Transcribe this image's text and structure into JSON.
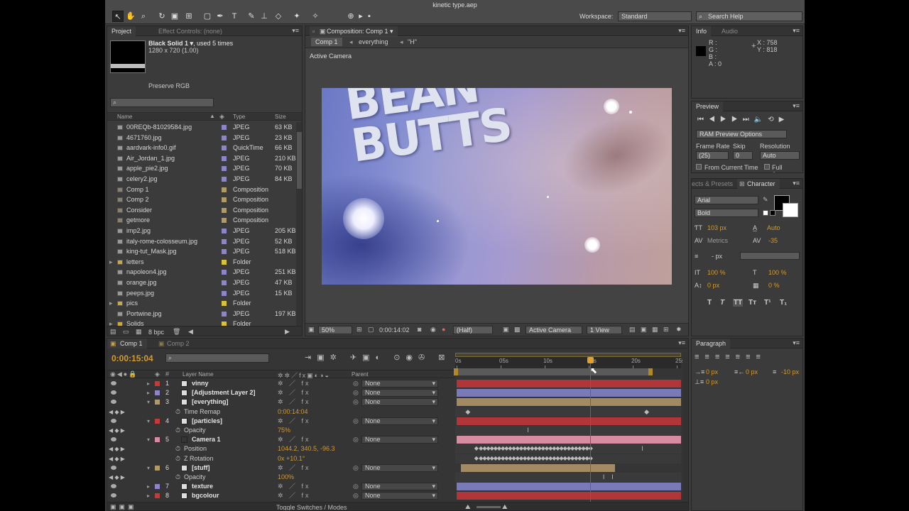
{
  "window": {
    "title": "kinetic type.aep"
  },
  "toolbar": {
    "workspace_label": "Workspace:",
    "workspace_value": "Standard",
    "search_placeholder": "Search Help"
  },
  "project": {
    "tabs": [
      "Project",
      "Effect Controls: (none)"
    ],
    "selected_name": "Black Solid 1 ▾",
    "selected_used": ", used 5 times",
    "selected_dims": "1280 x 720 (1.00)",
    "preserve": "Preserve RGB",
    "columns": {
      "name": "Name",
      "type": "Type",
      "size": "Size"
    },
    "items": [
      {
        "name": "00REQb-81029584.jpg",
        "type": "JPEG",
        "size": "63 KB",
        "color": "#8c86c9"
      },
      {
        "name": "4671760.jpg",
        "type": "JPEG",
        "size": "23 KB",
        "color": "#8c86c9"
      },
      {
        "name": "aardvark-info0.gif",
        "type": "QuickTime",
        "size": "66 KB",
        "color": "#8c86c9"
      },
      {
        "name": "Air_Jordan_1.jpg",
        "type": "JPEG",
        "size": "210 KB",
        "color": "#8c86c9"
      },
      {
        "name": "apple_pie2.jpg",
        "type": "JPEG",
        "size": "70 KB",
        "color": "#8c86c9"
      },
      {
        "name": "celery2.jpg",
        "type": "JPEG",
        "size": "84 KB",
        "color": "#8c86c9"
      },
      {
        "name": "Comp 1",
        "type": "Composition",
        "size": "",
        "color": "#b09a6a"
      },
      {
        "name": "Comp 2",
        "type": "Composition",
        "size": "",
        "color": "#b09a6a"
      },
      {
        "name": "Consider",
        "type": "Composition",
        "size": "",
        "color": "#b09a6a"
      },
      {
        "name": "getmore",
        "type": "Composition",
        "size": "",
        "color": "#b09a6a"
      },
      {
        "name": "imp2.jpg",
        "type": "JPEG",
        "size": "205 KB",
        "color": "#8c86c9"
      },
      {
        "name": "italy-rome-colosseum.jpg",
        "type": "JPEG",
        "size": "52 KB",
        "color": "#8c86c9"
      },
      {
        "name": "king-tut_Mask.jpg",
        "type": "JPEG",
        "size": "518 KB",
        "color": "#8c86c9"
      },
      {
        "name": "letters",
        "type": "Folder",
        "size": "",
        "color": "#d9c23a"
      },
      {
        "name": "napoleon4.jpg",
        "type": "JPEG",
        "size": "251 KB",
        "color": "#8c86c9"
      },
      {
        "name": "orange.jpg",
        "type": "JPEG",
        "size": "47 KB",
        "color": "#8c86c9"
      },
      {
        "name": "peeps.jpg",
        "type": "JPEG",
        "size": "15 KB",
        "color": "#8c86c9"
      },
      {
        "name": "pics",
        "type": "Folder",
        "size": "",
        "color": "#d9c23a"
      },
      {
        "name": "Portwine.jpg",
        "type": "JPEG",
        "size": "197 KB",
        "color": "#8c86c9"
      },
      {
        "name": "Solids",
        "type": "Folder",
        "size": "",
        "color": "#d9c23a"
      }
    ],
    "bpc": "8 bpc"
  },
  "composition": {
    "tab": "Composition: Comp 1",
    "crumbs": [
      "Comp 1",
      "everything",
      "\"H\""
    ],
    "view_label": "Active Camera",
    "canvas_text": "BEAN\nBUTTS",
    "zoom": "50%",
    "time": "0:00:14:02",
    "resolution": "(Half)",
    "camera": "Active Camera",
    "views": "1 View"
  },
  "info": {
    "tabs": [
      "Info",
      "Audio"
    ],
    "rgba": [
      "R :",
      "G :",
      "B :",
      "A : 0"
    ],
    "x": "X : 758",
    "y": "Y : 818"
  },
  "preview": {
    "tab": "Preview",
    "ram_options": "RAM Preview Options",
    "frame_rate_label": "Frame Rate",
    "skip_label": "Skip",
    "resolution_label": "Resolution",
    "frame_rate": "(25)",
    "skip": "0",
    "resolution": "Auto",
    "from_current": "From Current Time",
    "full_screen": "Full Screen"
  },
  "character": {
    "tabs": [
      "ects & Presets",
      "Character"
    ],
    "font": "Arial",
    "style": "Bold",
    "size": "103 px",
    "leading": "Auto",
    "kerning": "Metrics",
    "tracking": "-35",
    "stroke": "- px",
    "vscale": "100 %",
    "hscale": "100 %",
    "baseline": "0 px",
    "tsume": "0 %",
    "styles": [
      "T",
      "T",
      "TT",
      "Tт",
      "T¹",
      "T₁"
    ]
  },
  "paragraph": {
    "tab": "Paragraph",
    "indent_left": "0 px",
    "indent_right": "0 px",
    "first_line": "-10 px",
    "space_before": "0 px"
  },
  "timeline": {
    "tabs": [
      "Comp 1",
      "Comp 2"
    ],
    "time": "0:00:15:04",
    "col_layer": "Layer Name",
    "col_parent": "Parent",
    "ruler": [
      "0s",
      "05s",
      "10s",
      "15s",
      "20s",
      "25s"
    ],
    "toggle": "Toggle Switches / Modes",
    "rows": [
      {
        "kind": "layer",
        "num": "1",
        "name": "vinny",
        "color": "#c23a3a",
        "parent": "None",
        "bar": "#b0363a"
      },
      {
        "kind": "layer",
        "num": "2",
        "name": "[Adjustment Layer 2]",
        "color": "#8c86c9",
        "parent": "None",
        "bar": "#7b7ab8"
      },
      {
        "kind": "layer",
        "num": "3",
        "name": "[everything]",
        "color": "#b09a6a",
        "parent": "None",
        "bar": "#a48a62"
      },
      {
        "kind": "prop",
        "name": "Time Remap",
        "value": "0:00:14:04"
      },
      {
        "kind": "layer",
        "num": "4",
        "name": "[particles]",
        "color": "#c23a3a",
        "parent": "None",
        "bar": "#b0363a"
      },
      {
        "kind": "prop",
        "name": "Opacity",
        "value": "75%"
      },
      {
        "kind": "layer",
        "num": "5",
        "name": "Camera 1",
        "color": "#d98aa0",
        "parent": "None",
        "bar": "#d88ca2"
      },
      {
        "kind": "prop",
        "name": "Position",
        "value": "1044.2, 340.5, -96.3"
      },
      {
        "kind": "prop",
        "name": "Z Rotation",
        "value": "0x +10.1°"
      },
      {
        "kind": "layer",
        "num": "6",
        "name": "[stuff]",
        "color": "#b09a6a",
        "parent": "None",
        "bar": "#a48a62"
      },
      {
        "kind": "prop",
        "name": "Opacity",
        "value": "100%"
      },
      {
        "kind": "layer",
        "num": "7",
        "name": "texture",
        "color": "#8c86c9",
        "parent": "None",
        "bar": "#7b7ab8"
      },
      {
        "kind": "layer",
        "num": "8",
        "name": "bgcolour",
        "color": "#c23a3a",
        "parent": "None",
        "bar": "#b0363a"
      }
    ],
    "playhead_time_s": 15.16,
    "duration_s": 25
  },
  "colors": {
    "accent": "#d69a2a",
    "panel": "#3b3b3b",
    "playhead": "#e0303a"
  }
}
